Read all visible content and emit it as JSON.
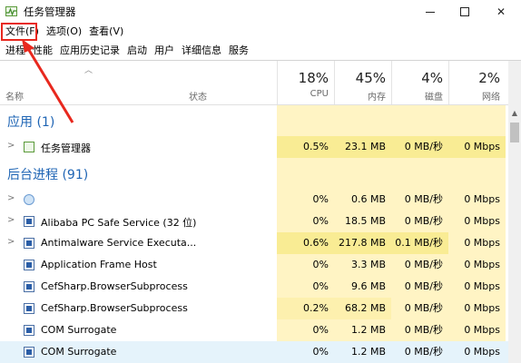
{
  "window": {
    "title": "任务管理器",
    "icon": "task-manager-icon"
  },
  "menu": [
    "文件(F)",
    "选项(O)",
    "查看(V)"
  ],
  "tabs": [
    "进程",
    "性能",
    "应用历史记录",
    "启动",
    "用户",
    "详细信息",
    "服务"
  ],
  "columns": {
    "name": "名称",
    "status": "状态",
    "cpu": {
      "pct": "18%",
      "label": "CPU"
    },
    "mem": {
      "pct": "45%",
      "label": "内存"
    },
    "disk": {
      "pct": "4%",
      "label": "磁盘"
    },
    "net": {
      "pct": "2%",
      "label": "网络"
    }
  },
  "groups": {
    "apps": "应用 (1)",
    "background": "后台进程 (91)"
  },
  "app_rows": [
    {
      "name": "任务管理器",
      "cpu": "0.5%",
      "mem": "23.1 MB",
      "disk": "0 MB/秒",
      "net": "0 Mbps"
    }
  ],
  "bg_rows": [
    {
      "name": "",
      "cpu": "0%",
      "mem": "0.6 MB",
      "disk": "0 MB/秒",
      "net": "0 Mbps"
    },
    {
      "name": "Alibaba PC Safe Service (32 位)",
      "cpu": "0%",
      "mem": "18.5 MB",
      "disk": "0 MB/秒",
      "net": "0 Mbps"
    },
    {
      "name": "Antimalware Service Executa...",
      "cpu": "0.6%",
      "mem": "217.8 MB",
      "disk": "0.1 MB/秒",
      "net": "0 Mbps"
    },
    {
      "name": "Application Frame Host",
      "cpu": "0%",
      "mem": "3.3 MB",
      "disk": "0 MB/秒",
      "net": "0 Mbps"
    },
    {
      "name": "CefSharp.BrowserSubprocess",
      "cpu": "0%",
      "mem": "9.6 MB",
      "disk": "0 MB/秒",
      "net": "0 Mbps"
    },
    {
      "name": "CefSharp.BrowserSubprocess",
      "cpu": "0.2%",
      "mem": "68.2 MB",
      "disk": "0 MB/秒",
      "net": "0 Mbps"
    },
    {
      "name": "COM Surrogate",
      "cpu": "0%",
      "mem": "1.2 MB",
      "disk": "0 MB/秒",
      "net": "0 Mbps"
    },
    {
      "name": "COM Surrogate",
      "cpu": "0%",
      "mem": "1.2 MB",
      "disk": "0 MB/秒",
      "net": "0 Mbps"
    }
  ],
  "colors": {
    "accent": "#1e64b4",
    "highlight": "#e8281e",
    "heat_light": "#fff4c4",
    "heat_medium": "#f9ec94"
  }
}
